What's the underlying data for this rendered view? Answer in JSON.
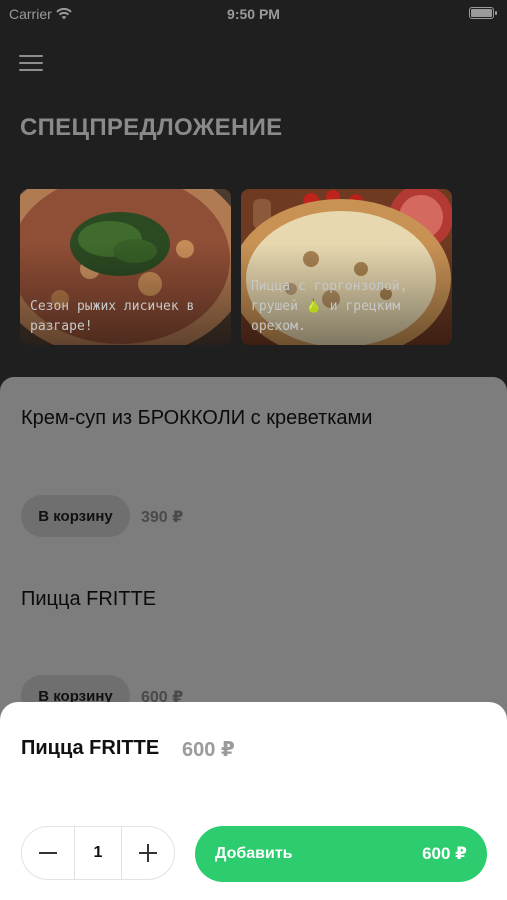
{
  "status_bar": {
    "carrier": "Carrier",
    "time": "9:50 PM"
  },
  "header": {
    "section_title": "СПЕЦПРЕДЛОЖЕНИЕ"
  },
  "promos": [
    {
      "text": "Сезон рыжих лисичек в разгаре!"
    },
    {
      "text": "Пицца с горгонзолой, грушей 🍐 и грецким орехом."
    }
  ],
  "products": [
    {
      "title": "Крем-суп из БРОККОЛИ с креветками",
      "cart_label": "В корзину",
      "price": "390 ₽"
    },
    {
      "title": "Пицца FRITTE",
      "cart_label": "В корзину",
      "price": "600 ₽"
    }
  ],
  "add_sheet": {
    "title": "Пицца FRITTE",
    "price": "600 ₽",
    "quantity": "1",
    "add_label": "Добавить",
    "add_price": "600 ₽"
  },
  "colors": {
    "accent": "#2dcc6f",
    "background": "#1f1f1f"
  }
}
